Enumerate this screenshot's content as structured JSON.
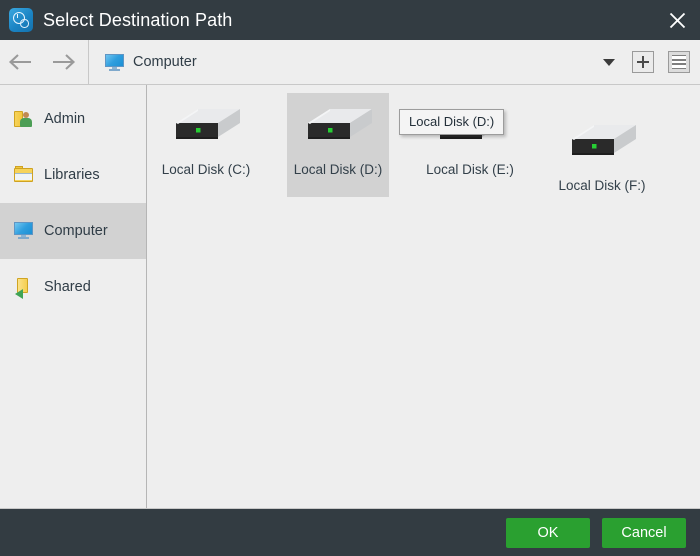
{
  "window": {
    "title": "Select Destination Path",
    "title_icon": "app-clock-icon",
    "close_icon": "close-icon",
    "titlebar_color": "#333c42"
  },
  "toolbar": {
    "back_icon": "arrow-left-icon",
    "forward_icon": "arrow-right-icon",
    "breadcrumb_icon": "computer-monitor-icon",
    "breadcrumb_label": "Computer",
    "dropdown_icon": "chevron-down-icon",
    "new_folder_icon": "plus-icon",
    "view_icon": "list-view-icon"
  },
  "sidebar": {
    "items": [
      {
        "label": "Admin",
        "icon": "user-folder-icon",
        "selected": false
      },
      {
        "label": "Libraries",
        "icon": "libraries-folder-icon",
        "selected": false
      },
      {
        "label": "Computer",
        "icon": "computer-monitor-icon",
        "selected": true
      },
      {
        "label": "Shared",
        "icon": "shared-folder-icon",
        "selected": false
      }
    ]
  },
  "content": {
    "items": [
      {
        "label": "Local Disk (C:)",
        "icon": "hard-drive-icon",
        "selected": false
      },
      {
        "label": "Local Disk (D:)",
        "icon": "hard-drive-icon",
        "selected": true
      },
      {
        "label": "Local Disk (E:)",
        "icon": "hard-drive-icon",
        "selected": false
      },
      {
        "label": "Local Disk (F:)",
        "icon": "hard-drive-icon",
        "selected": false
      }
    ],
    "tooltip": "Local Disk (D:)"
  },
  "footer": {
    "ok_label": "OK",
    "cancel_label": "Cancel",
    "button_color": "#2aa030",
    "background_color": "#333c42"
  }
}
